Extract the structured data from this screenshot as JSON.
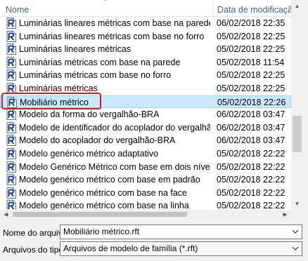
{
  "columns": {
    "name": "Nome",
    "date": "Data de modificação"
  },
  "files": [
    {
      "name": "Luminárias lineares métricas com base na parede",
      "date": "06/02/2018 22:35",
      "selected": false
    },
    {
      "name": "Luminárias lineares métricas com base no forro",
      "date": "05/02/2018 22:25",
      "selected": false
    },
    {
      "name": "Luminárias lineares métricas",
      "date": "05/02/2018 22:25",
      "selected": false
    },
    {
      "name": "Luminárias métricas com base na parede",
      "date": "05/02/2018 11:54",
      "selected": false
    },
    {
      "name": "Luminárias métricas com base no forro",
      "date": "05/02/2018 22:25",
      "selected": false
    },
    {
      "name": "Luminárias métricas",
      "date": "05/02/2018 22:25",
      "selected": false
    },
    {
      "name": "Mobiliário métrico",
      "date": "05/02/2018 22:26",
      "selected": true
    },
    {
      "name": "Modelo da forma do vergalhão-BRA",
      "date": "06/02/2018 03:47",
      "selected": false
    },
    {
      "name": "Modelo de identificador do acoplador do vergalhã...",
      "date": "06/02/2018 03:47",
      "selected": false
    },
    {
      "name": "Modelo do acoplador do vergalhão-BRA",
      "date": "06/02/2018 03:47",
      "selected": false
    },
    {
      "name": "Modelo genérico métrico adaptativo",
      "date": "05/02/2018 22:22",
      "selected": false
    },
    {
      "name": "Modelo Genérico Métrico com base em dois níveis",
      "date": "05/02/2018 22:22",
      "selected": false
    },
    {
      "name": "Modelo genérico métrico com base em padrão",
      "date": "05/02/2018 22:22",
      "selected": false
    },
    {
      "name": "Modelo genérico métrico com base na face",
      "date": "05/02/2018 22:22",
      "selected": false
    },
    {
      "name": "Modelo genérico métrico com base na linha",
      "date": "05/02/2018 22:22",
      "selected": false
    }
  ],
  "filename": {
    "label": "Nome do arquivo:",
    "value": "Mobiliário métrico.rft"
  },
  "filetype": {
    "label": "Arquivos do tipo:",
    "value": "Arquivos de modelo de família  (*.rft)"
  },
  "icon": "revit-family-file-icon",
  "colors": {
    "selection": "#cce8ff",
    "selection_border": "#99d1ff",
    "highlight": "#d91a1a",
    "header_text": "#4c607a"
  }
}
